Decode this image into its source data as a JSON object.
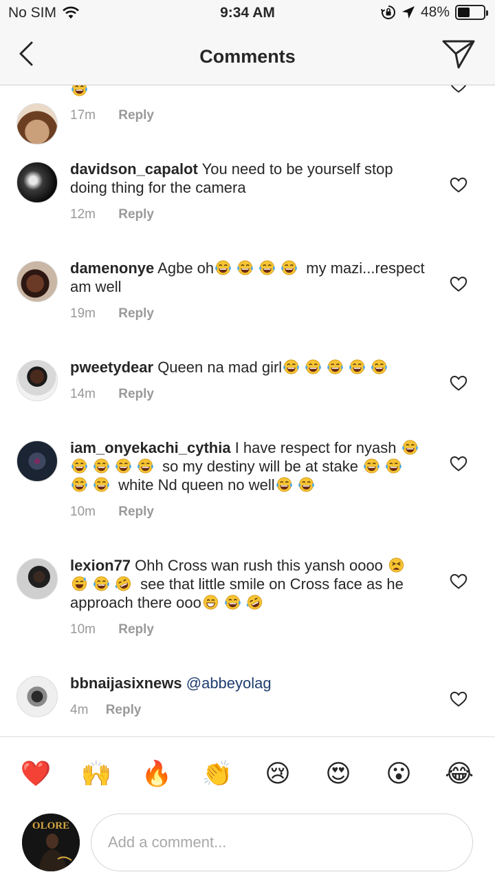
{
  "status_bar": {
    "carrier": "No SIM",
    "time": "9:34 AM",
    "battery": "48%",
    "battery_level": 0.48
  },
  "nav": {
    "title": "Comments",
    "back_icon": "chevron-left-icon",
    "share_icon": "send-icon"
  },
  "partial_comment": {
    "time": "17m",
    "reply_label": "Reply"
  },
  "comments": [
    {
      "username": "davidson_capalot",
      "text": "You need to be yourself stop doing thing for the camera",
      "time": "12m",
      "reply_label": "Reply"
    },
    {
      "username": "damenonye",
      "text_a": "Agbe oh",
      "text_b": " my mazi...respect am well",
      "time": "19m",
      "reply_label": "Reply"
    },
    {
      "username": "pweetydear",
      "text_a": "Queen na mad girl",
      "time": "14m",
      "reply_label": "Reply"
    },
    {
      "username": "iam_onyekachi_cythia",
      "text_a": "I have respect for nyash",
      "text_b": " so my destiny will be at stake",
      "text_c": " white Nd queen no well",
      "time": "10m",
      "reply_label": "Reply"
    },
    {
      "username": "lexion77",
      "text_a": "Ohh Cross wan rush this yansh oooo",
      "text_b": " see that little smile on Cross face as he approach there ooo",
      "time": "10m",
      "reply_label": "Reply"
    },
    {
      "username": "bbnaijasixnews",
      "mention": "@abbeyolag",
      "time": "4m",
      "reply_label": "Reply"
    }
  ],
  "reactions": [
    "❤️",
    "🙌",
    "🔥",
    "👏",
    "😢",
    "😍",
    "😮",
    "😂"
  ],
  "composer": {
    "placeholder": "Add a comment...",
    "avatar_text": "OLORE"
  },
  "colors": {
    "text": "#262626",
    "muted": "#999999",
    "mention": "#1e3c6e",
    "bar_bg": "#f7f7f7"
  }
}
